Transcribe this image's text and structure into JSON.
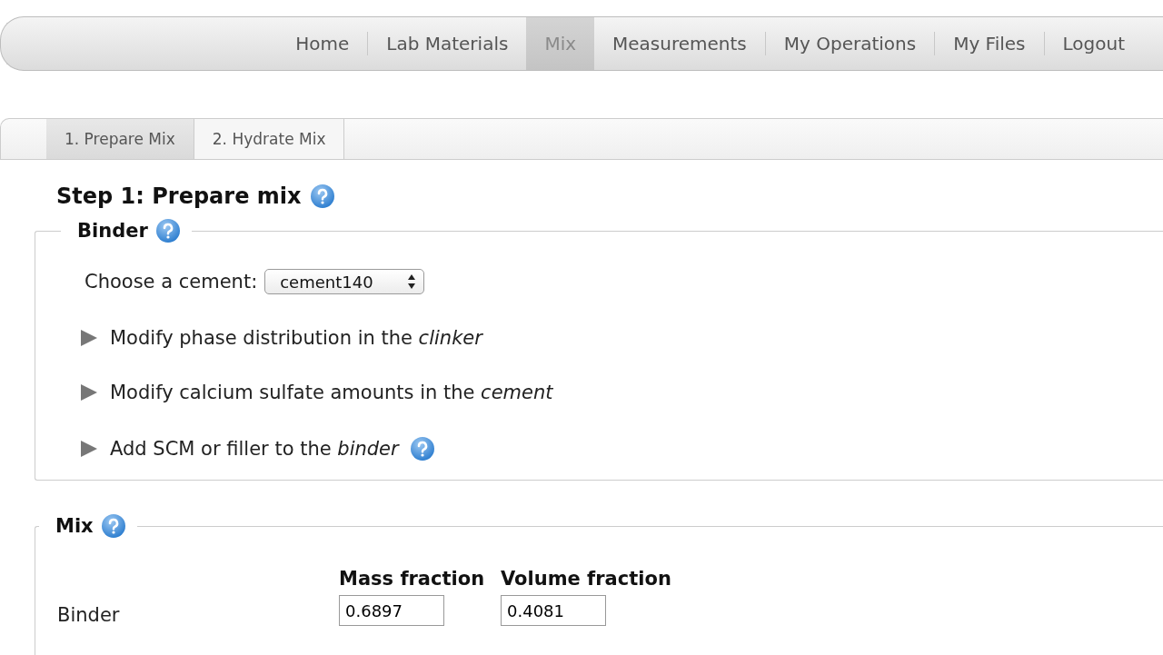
{
  "nav": {
    "items": [
      {
        "label": "Home",
        "selected": false
      },
      {
        "label": "Lab Materials",
        "selected": false
      },
      {
        "label": "Mix",
        "selected": true
      },
      {
        "label": "Measurements",
        "selected": false
      },
      {
        "label": "My Operations",
        "selected": false
      },
      {
        "label": "My Files",
        "selected": false
      },
      {
        "label": "Logout",
        "selected": false
      }
    ]
  },
  "subtabs": [
    {
      "label": "1. Prepare Mix",
      "selected": true
    },
    {
      "label": "2. Hydrate Mix",
      "selected": false
    }
  ],
  "heading": "Step 1: Prepare mix",
  "binder": {
    "legend": "Binder",
    "cement_label": "Choose a cement:",
    "cement_value": "cement140",
    "sections": [
      {
        "label": "Modify phase distribution in the *clinker*",
        "expanded": false,
        "help": false
      },
      {
        "label": "Modify calcium sulfate amounts in the *cement*",
        "expanded": false,
        "help": false
      },
      {
        "label": "Add SCM or filler to the *binder*",
        "expanded": false,
        "help": true
      }
    ]
  },
  "mix": {
    "legend": "Mix",
    "columns": [
      "Mass fraction",
      "Volume fraction"
    ],
    "rows": [
      {
        "label": "Binder",
        "values": [
          "0.6897",
          "0.4081"
        ]
      }
    ]
  }
}
